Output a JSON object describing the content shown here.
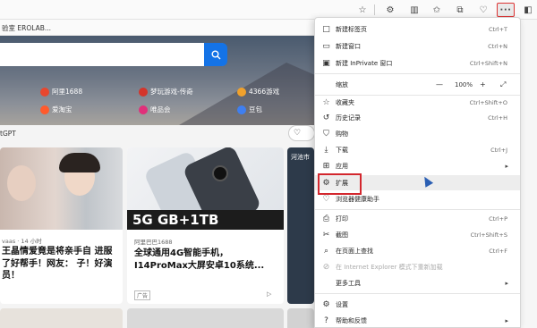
{
  "favbar": {
    "text": "验室 EROLAB..."
  },
  "toolbar": {
    "more_label": "···"
  },
  "hero": {
    "quick_links": [
      {
        "label": "阿里1688",
        "color": "#e8472e"
      },
      {
        "label": "梦玩游戏-传奇",
        "color": "#d4352b"
      },
      {
        "label": "4366游戏",
        "color": "#f0a12c"
      },
      {
        "label": "爱淘宝",
        "color": "#ff5a2c"
      },
      {
        "label": "唯品会",
        "color": "#e0307a"
      },
      {
        "label": "豆包",
        "color": "#3f7ff0"
      }
    ]
  },
  "feed": {
    "chatgpt_label": "tGPT",
    "card1": {
      "source": "vaas · 14 小时",
      "title": "王晶情爱竟是将亲手自 进服了好帮手！网友： 子！好演员！"
    },
    "card2": {
      "banner": "5G  GB+1TB",
      "source": "阿里巴巴1688",
      "title": "全球通用4G智能手机， I14ProMax大屏安卓10系统...",
      "ad_label": "广告",
      "play_icon": "▷"
    },
    "card3": {
      "label": "河池市"
    }
  },
  "menu": {
    "items": [
      {
        "icon": "□",
        "label": "新建标签页",
        "shortcut": "Ctrl+T"
      },
      {
        "icon": "▭",
        "label": "新建窗口",
        "shortcut": "Ctrl+N"
      },
      {
        "icon": "▣",
        "label": "新建 InPrivate 窗口",
        "shortcut": "Ctrl+Shift+N"
      },
      {
        "icon": "☆",
        "label": "收藏夹",
        "shortcut": "Ctrl+Shift+O"
      },
      {
        "icon": "↺",
        "label": "历史记录",
        "shortcut": "Ctrl+H"
      },
      {
        "icon": "⛉",
        "label": "购物",
        "shortcut": ""
      },
      {
        "icon": "⤓",
        "label": "下载",
        "shortcut": "Ctrl+J"
      },
      {
        "icon": "⊞",
        "label": "应用",
        "shortcut": ""
      },
      {
        "icon": "⚙",
        "label": "扩展",
        "shortcut": ""
      },
      {
        "icon": "♡",
        "label": "浏览器健康助手",
        "shortcut": ""
      },
      {
        "icon": "⎙",
        "label": "打印",
        "shortcut": "Ctrl+P"
      },
      {
        "icon": "✂",
        "label": "截图",
        "shortcut": "Ctrl+Shift+S"
      },
      {
        "icon": "⌕",
        "label": "在页面上查找",
        "shortcut": "Ctrl+F"
      },
      {
        "icon": "⊘",
        "label": "在 Internet Explorer 模式下重新加载",
        "shortcut": ""
      },
      {
        "icon": "",
        "label": "更多工具",
        "shortcut": ""
      },
      {
        "icon": "⚙",
        "label": "设置",
        "shortcut": ""
      },
      {
        "icon": "?",
        "label": "帮助和反馈",
        "shortcut": ""
      }
    ],
    "zoom": {
      "label": "缩放",
      "minus": "—",
      "value": "100%",
      "plus": "+",
      "expand": "⤢"
    },
    "arrow": "▸"
  }
}
